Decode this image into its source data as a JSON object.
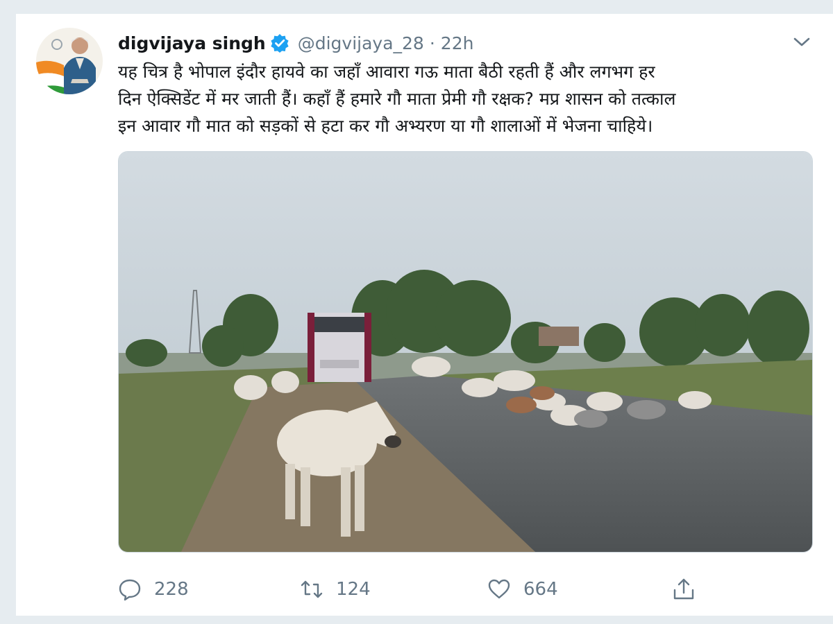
{
  "tweet": {
    "author": {
      "name": "digvijaya singh",
      "handle": "@digvijaya_28",
      "verified": true
    },
    "separator": "·",
    "time": "22h",
    "text_lines": [
      "यह चित्र है भोपाल इंदौर हायवे का जहाँ आवारा गऊ माता बैठी रहती हैं और लगभग हर",
      "दिन ऐक्सिडेंट में मर जाती हैं। कहाँ हैं हमारे गौ माता प्रेमी गौ रक्षक? मप्र शासन को तत्काल",
      "इन आवार गौ मात को सड़कों से हटा कर गौ अभ्यरण या गौ शालाओं में भेजना चाहिये।"
    ],
    "stats": {
      "replies": "228",
      "retweets": "124",
      "likes": "664"
    }
  },
  "icons": {
    "verified": "verified-badge-icon",
    "caret": "chevron-down-icon",
    "reply": "reply-icon",
    "retweet": "retweet-icon",
    "like": "heart-icon",
    "share": "share-icon"
  },
  "colors": {
    "verified_blue": "#1da1f2",
    "text": "#14171a",
    "muted": "#657786",
    "background": "#e6ecf0"
  }
}
